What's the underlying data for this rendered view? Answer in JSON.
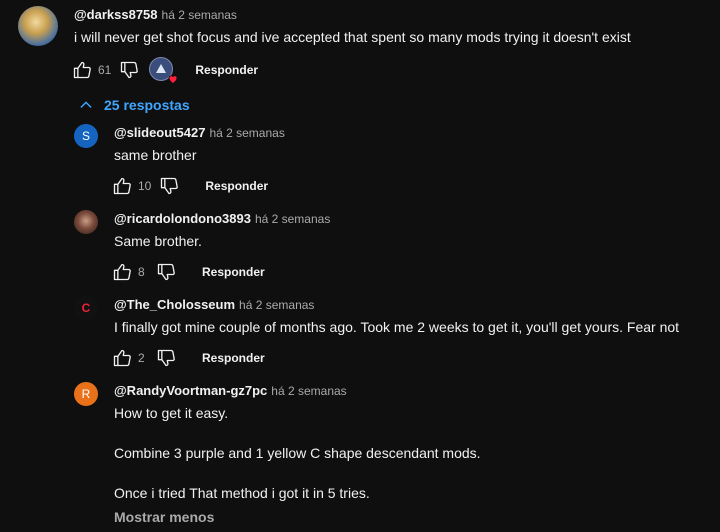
{
  "reply_label": "Responder",
  "main_comment": {
    "author": "@darkss8758",
    "time": "há 2 semanas",
    "text": "i will never get shot focus and ive accepted that spent so many mods trying it doesn't exist",
    "likes": "61"
  },
  "replies_toggle": "25 respostas",
  "replies": [
    {
      "author": "@slideout5427",
      "time": "há 2 semanas",
      "text": "same brother",
      "likes": "10",
      "avatar_letter": "S",
      "avatar_color": "#1565c0"
    },
    {
      "author": "@ricardolondono3893",
      "time": "há 2 semanas",
      "text": "Same brother.",
      "likes": "8"
    },
    {
      "author": "@The_Cholosseum",
      "time": "há 2 semanas",
      "text": "I finally got mine couple of months ago. Took me 2 weeks to get it, you'll get yours. Fear not",
      "likes": "2",
      "avatar_letter": "C"
    },
    {
      "author": "@RandyVoortman-gz7pc",
      "time": "há 2 semanas",
      "avatar_letter": "R",
      "avatar_color": "#e8711a",
      "lines": [
        "How to get it easy.",
        "Combine 3 purple and 1 yellow C shape descendant mods.",
        "Once i tried That method i got it in 5 tries."
      ]
    }
  ],
  "show_less": "Mostrar menos"
}
